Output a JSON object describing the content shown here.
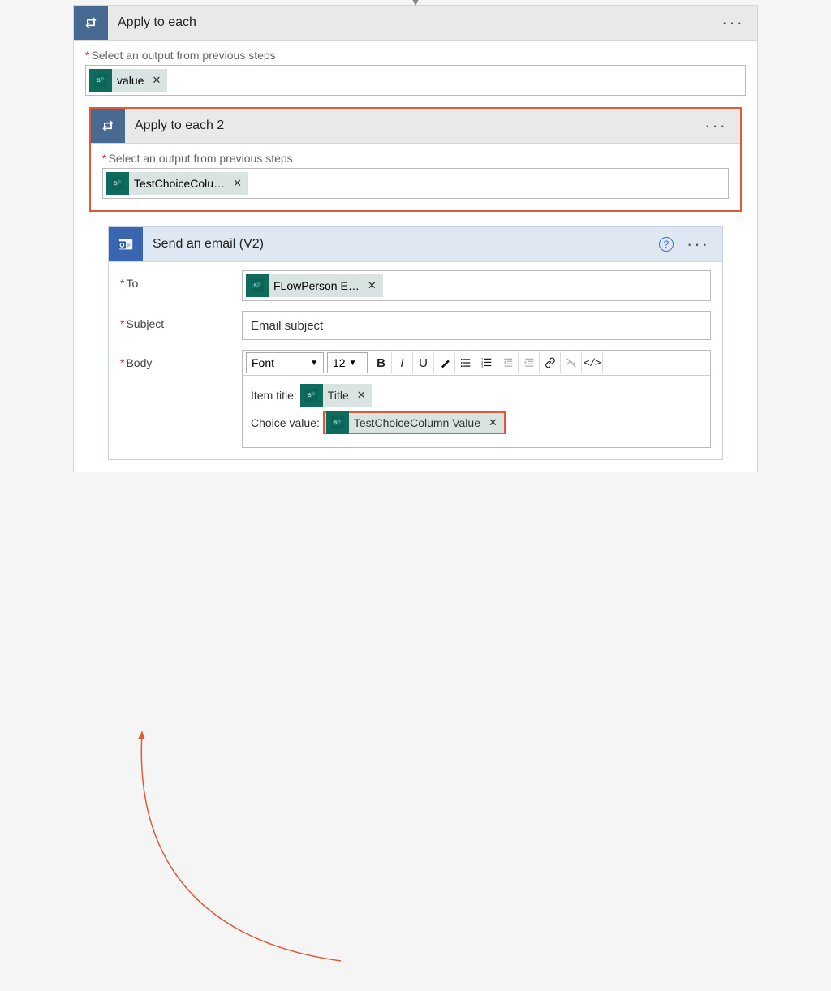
{
  "outer": {
    "title": "Apply to each",
    "output_label": "Select an output from previous steps",
    "token": "value"
  },
  "inner_loop": {
    "title": "Apply to each 2",
    "output_label": "Select an output from previous steps",
    "token": "TestChoiceColu…"
  },
  "email": {
    "title": "Send an email (V2)",
    "fields": {
      "to_label": "To",
      "to_token": "FLowPerson E…",
      "subject_label": "Subject",
      "subject_value": "Email subject",
      "body_label": "Body"
    },
    "toolbar": {
      "font": "Font",
      "size": "12"
    },
    "body": {
      "line1_label": "Item title:",
      "line1_token": "Title",
      "line2_label": "Choice value:",
      "line2_token": "TestChoiceColumn Value"
    }
  }
}
